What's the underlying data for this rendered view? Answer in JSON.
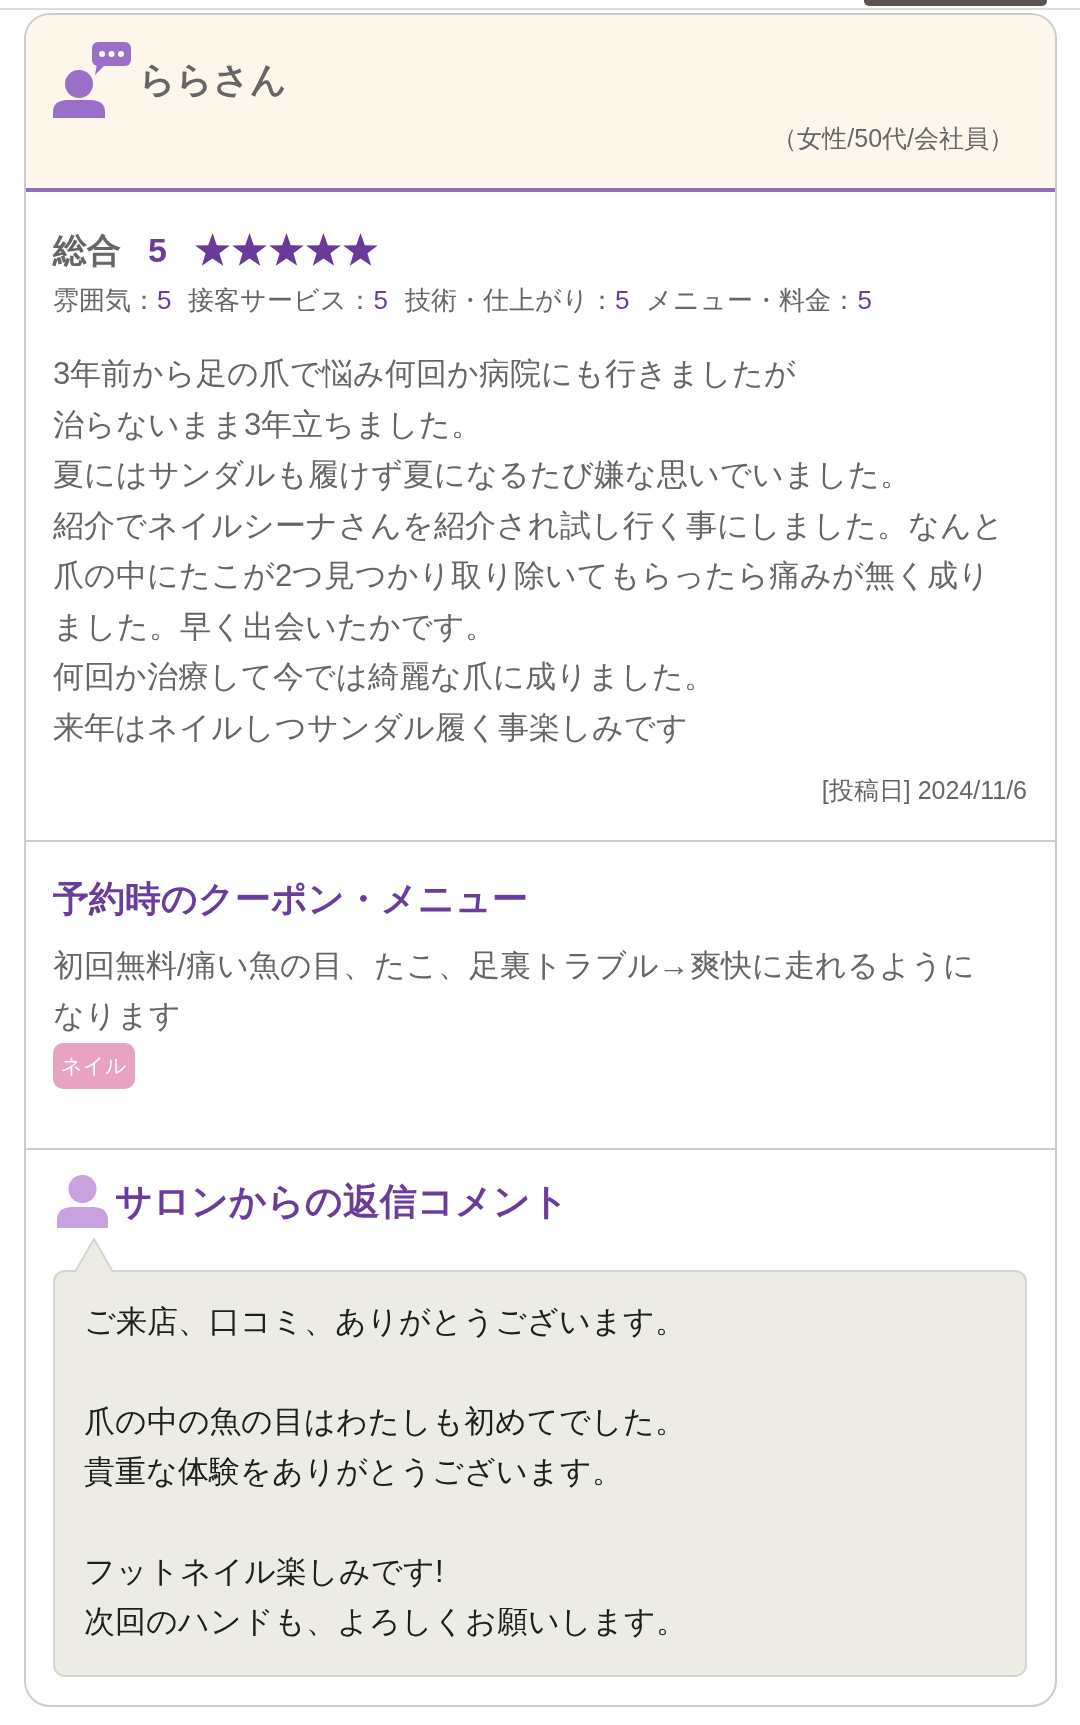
{
  "reviewer": {
    "name": "ららさん",
    "profile": "（女性/50代/会社員）"
  },
  "overall": {
    "label": "総合",
    "score": "5",
    "stars": 5
  },
  "sub_ratings": [
    {
      "label": "雰囲気：",
      "score": "5"
    },
    {
      "label": "接客サービス：",
      "score": "5"
    },
    {
      "label": "技術・仕上がり：",
      "score": "5"
    },
    {
      "label": "メニュー・料金：",
      "score": "5"
    }
  ],
  "review": {
    "lines": [
      "3年前から足の爪で悩み何回か病院にも行きましたが",
      "治らないまま3年立ちました。",
      "夏にはサンダルも履けず夏になるたび嫌な思いでいました。",
      "紹介でネイルシーナさんを紹介され試し行く事にしました。なんと爪の中にたこが2つ見つかり取り除いてもらったら痛みが無く成りました。早く出会いたかです。",
      "何回か治療して今では綺麗な爪に成りました。",
      "来年はネイルしつサンダル履く事楽しみです"
    ],
    "posted": "[投稿日] 2024/11/6"
  },
  "coupon": {
    "title": "予約時のクーポン・メニュー",
    "text": "初回無料/痛い魚の目、たこ、足裏トラブル→爽快に走れるようになります",
    "tags": [
      "ネイル"
    ]
  },
  "reply": {
    "title": "サロンからの返信コメント",
    "paragraphs": [
      [
        "ご来店、口コミ、ありがとうございます。"
      ],
      [
        "爪の中の魚の目はわたしも初めてでした。",
        "貴重な体験をありがとうございます。"
      ],
      [
        "フットネイル楽しみです!",
        "次回のハンドも、よろしくお願いします。"
      ]
    ]
  }
}
